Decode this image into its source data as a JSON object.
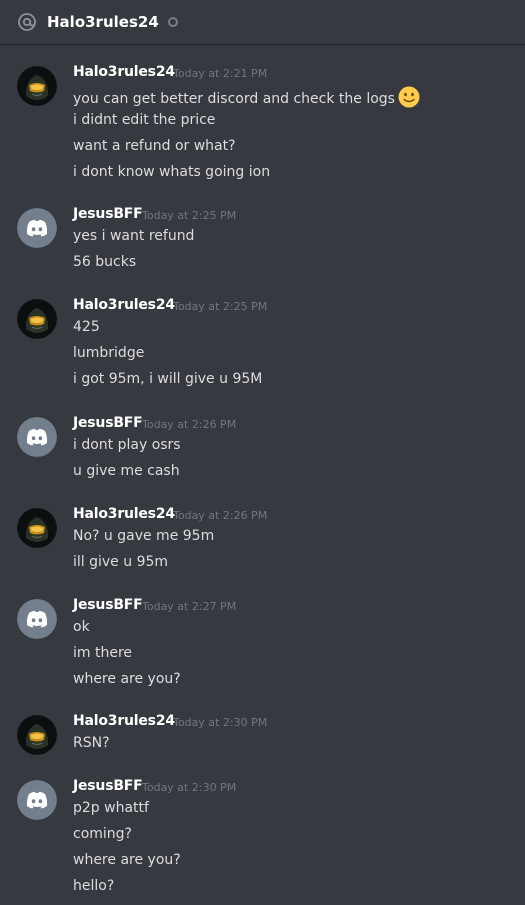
{
  "header": {
    "title": "Halo3rules24"
  },
  "messages": [
    {
      "author": "Halo3rules24",
      "avatar": "halo-helmet-icon",
      "timestamp": "Today at 2:21 PM",
      "lines": [
        "you can get better discord and check the logs",
        "i didnt edit the price",
        "want a refund or what?",
        "i dont know whats going ion"
      ],
      "emoji": "slight-smile-emoji"
    },
    {
      "author": "JesusBFF",
      "avatar": "discord-logo-icon",
      "timestamp": "Today at 2:25 PM",
      "lines": [
        "yes i want refund",
        "56 bucks"
      ]
    },
    {
      "author": "Halo3rules24",
      "avatar": "halo-helmet-icon",
      "timestamp": "Today at 2:25 PM",
      "lines": [
        "425",
        "lumbridge",
        "i got 95m, i will give u 95M"
      ]
    },
    {
      "author": "JesusBFF",
      "avatar": "discord-logo-icon",
      "timestamp": "Today at 2:26 PM",
      "lines": [
        "i dont play osrs",
        "u give me cash"
      ]
    },
    {
      "author": "Halo3rules24",
      "avatar": "halo-helmet-icon",
      "timestamp": "Today at 2:26 PM",
      "lines": [
        "No? u gave me 95m",
        "ill give u 95m"
      ]
    },
    {
      "author": "JesusBFF",
      "avatar": "discord-logo-icon",
      "timestamp": "Today at 2:27 PM",
      "lines": [
        "ok",
        "im there",
        "where are you?"
      ]
    },
    {
      "author": "Halo3rules24",
      "avatar": "halo-helmet-icon",
      "timestamp": "Today at 2:30 PM",
      "lines": [
        "RSN?"
      ]
    },
    {
      "author": "JesusBFF",
      "avatar": "discord-logo-icon",
      "timestamp": "Today at 2:30 PM",
      "lines": [
        "p2p whattf",
        "coming?",
        "where are you?",
        "hello?"
      ]
    }
  ],
  "colors": {
    "background": "#36393f",
    "username": "#ffffff",
    "text": "#dcddde",
    "timestamp": "#72767d",
    "discord_blurple": "#7289da"
  }
}
